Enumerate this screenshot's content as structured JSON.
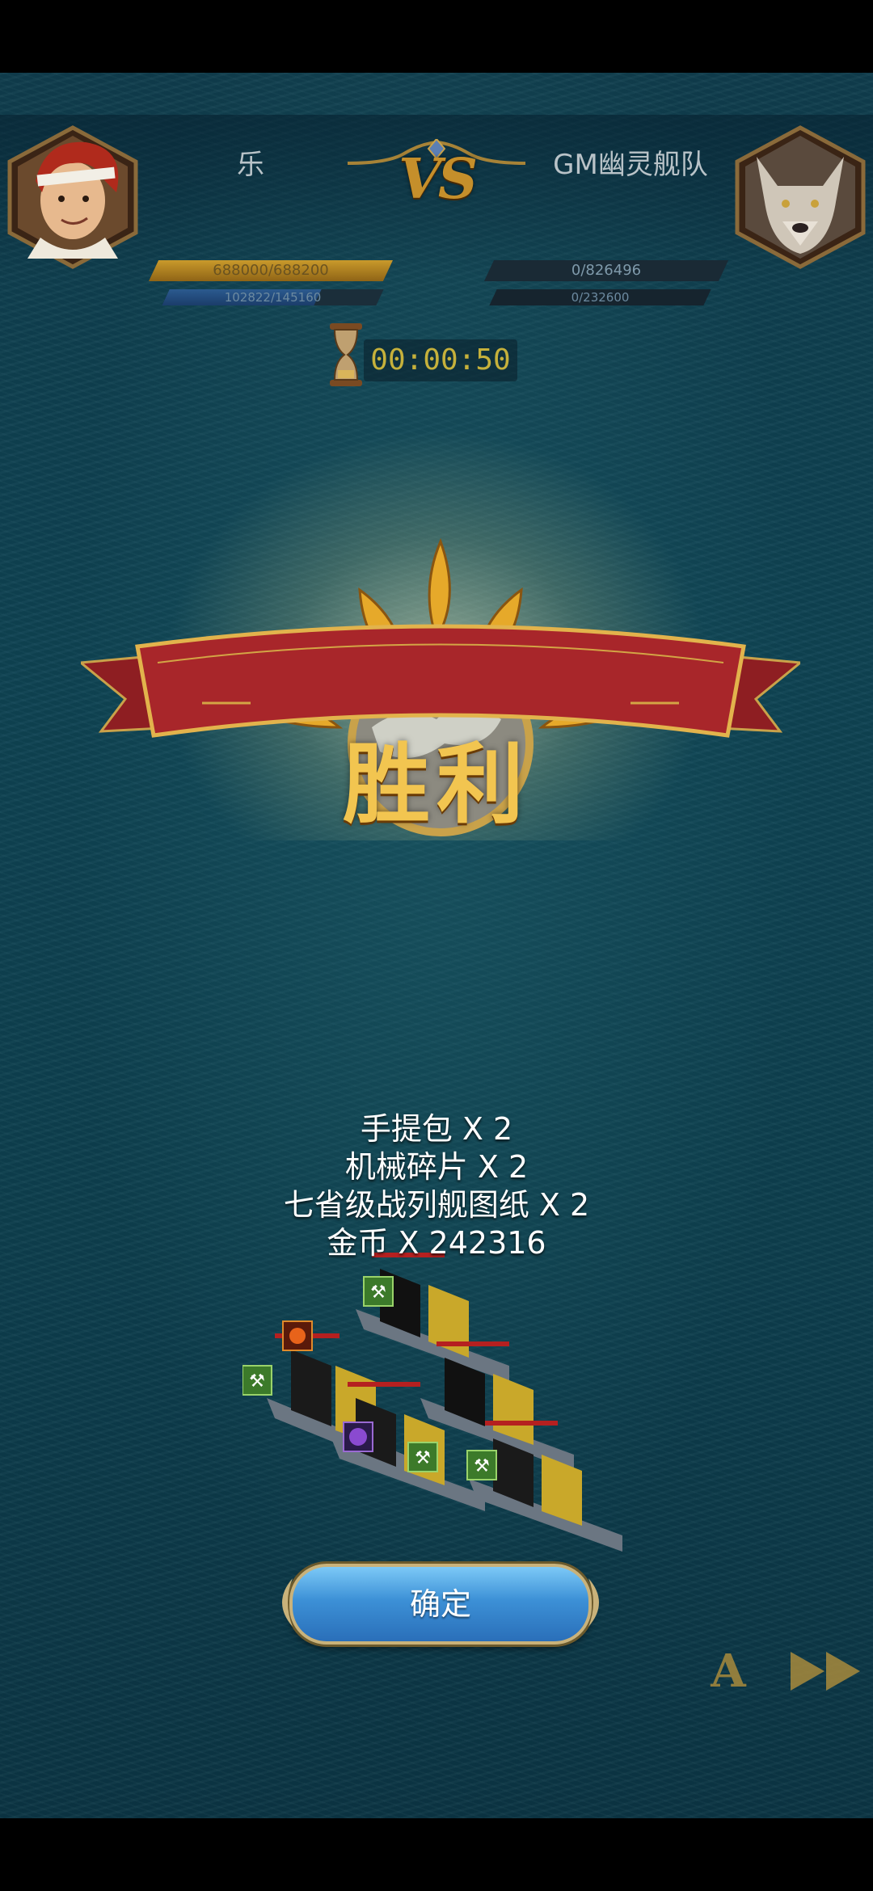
{
  "hud": {
    "player_name": "乐",
    "player_hp_text": "688000/688200",
    "player_hp_fraction": 0.9997,
    "player_sub_text": "102822/145160",
    "player_sub_fraction": 0.708,
    "vs_label": "VS",
    "enemy_name": "GM幽灵舰队",
    "enemy_hp_text": "0/826496",
    "enemy_sub_text": "0/232600",
    "timer": "00:00:50"
  },
  "result": {
    "title": "胜利"
  },
  "rewards": [
    "手提包 X 2",
    "机械碎片 X 2",
    "七省级战列舰图纸 X 2",
    "金币 X 242316"
  ],
  "buttons": {
    "confirm_label": "确定",
    "auto_label": "A"
  },
  "icons": {
    "hourglass": "hourglass-icon",
    "speed": "fast-forward-icon",
    "player_avatar": "red-haired-captain-avatar",
    "enemy_avatar": "wolf-avatar"
  },
  "colors": {
    "sea": "#0e4353",
    "gold": "#f2c550",
    "banner_red": "#a8262a",
    "button_blue": "#3c90d6",
    "timer_yellow": "#c6b13b"
  }
}
